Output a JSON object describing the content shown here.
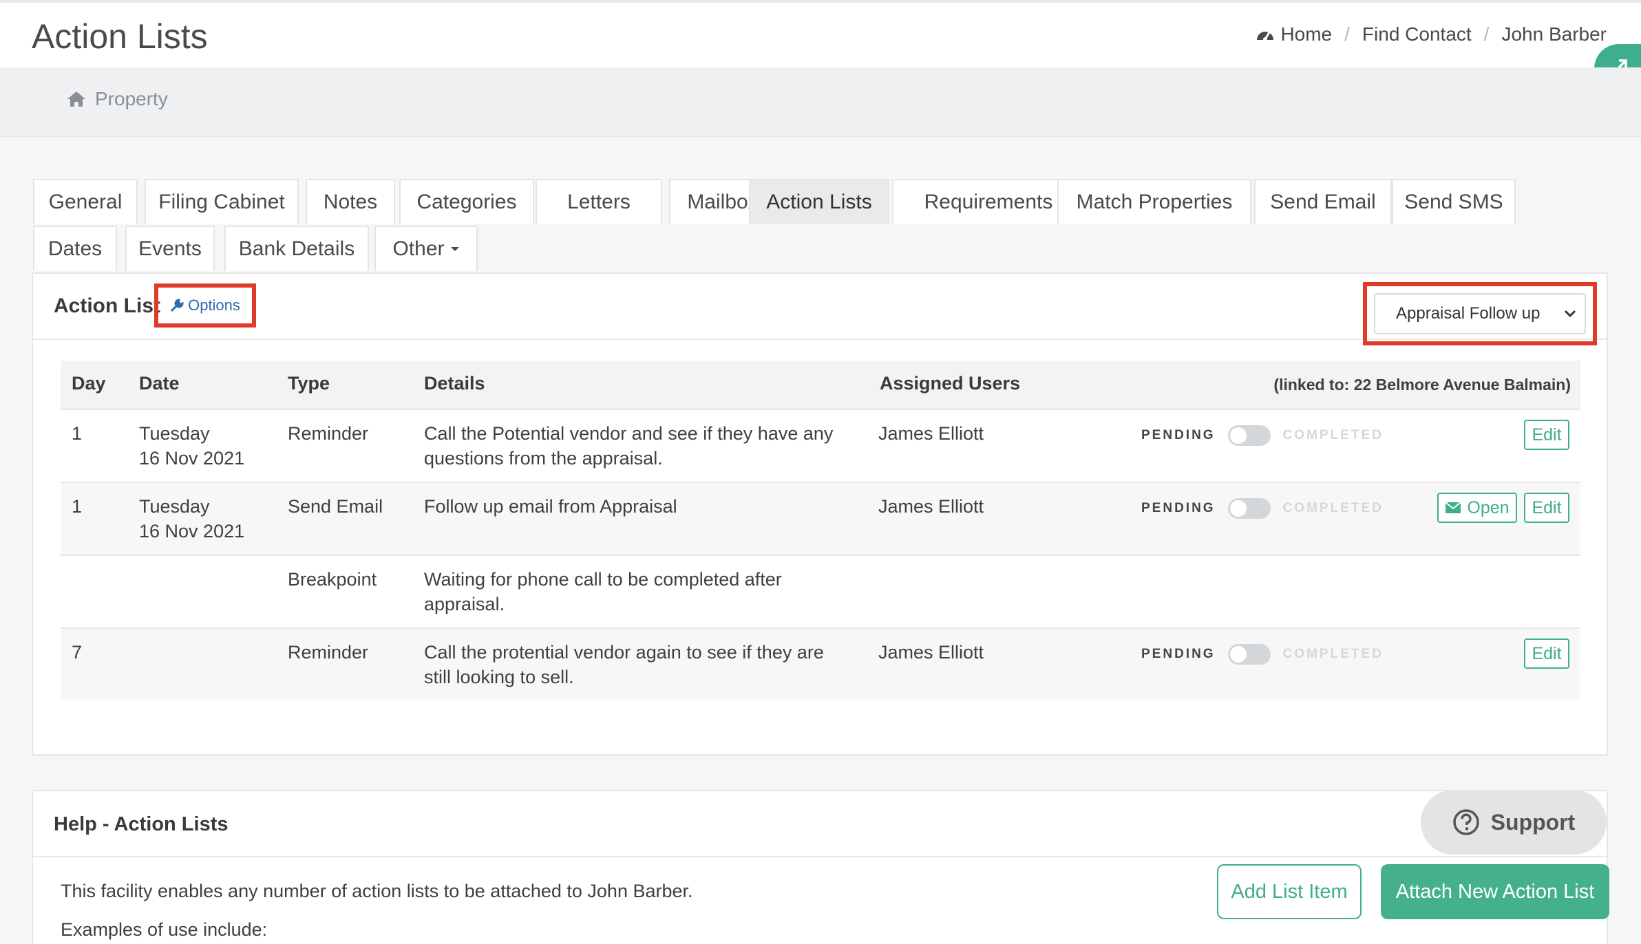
{
  "header": {
    "title": "Action Lists",
    "breadcrumb": [
      "Home",
      "Find Contact",
      "John Barber"
    ]
  },
  "subnav": {
    "property_label": "Property"
  },
  "tabs": [
    {
      "label": "General"
    },
    {
      "label": "Filing Cabinet"
    },
    {
      "label": "Notes"
    },
    {
      "label": "Categories"
    },
    {
      "label": "Letters"
    },
    {
      "label": "Mailbox"
    },
    {
      "label": "Action Lists",
      "active": true
    },
    {
      "label": "Requirements"
    },
    {
      "label": "Match Properties"
    },
    {
      "label": "Send Email"
    },
    {
      "label": "Send SMS"
    },
    {
      "label": "Dates"
    },
    {
      "label": "Events"
    },
    {
      "label": "Bank Details"
    },
    {
      "label": "Other"
    }
  ],
  "action_list": {
    "title": "Action List",
    "options_label": "Options",
    "selected_list": "Appraisal Follow up",
    "columns": [
      "Day",
      "Date",
      "Type",
      "Details",
      "Assigned Users"
    ],
    "linked_to": "(linked to: 22 Belmore Avenue Balmain)",
    "status_pending": "PENDING",
    "status_completed": "COMPLETED",
    "edit_label": "Edit",
    "open_label": "Open",
    "rows": [
      {
        "day": "1",
        "date_day": "Tuesday",
        "date": "16 Nov 2021",
        "type": "Reminder",
        "details_1": "Call the Potential vendor and see if they have any",
        "details_2": "questions from the appraisal.",
        "user": "James Elliott"
      },
      {
        "day": "1",
        "date_day": "Tuesday",
        "date": "16 Nov 2021",
        "type": "Send Email",
        "details_1": "Follow up email from Appraisal",
        "details_2": "",
        "user": "James Elliott"
      },
      {
        "day": "",
        "date_day": "",
        "date": "",
        "type": "Breakpoint",
        "details_1": "Waiting for phone call to be completed after",
        "details_2": "appraisal.",
        "user": ""
      },
      {
        "day": "7",
        "date_day": "",
        "date": "",
        "type": "Reminder",
        "details_1": "Call the protential vendor again to see if they are",
        "details_2": "still looking to sell.",
        "user": "James Elliott"
      }
    ]
  },
  "help": {
    "title": "Help - Action Lists",
    "support_label": "Support",
    "line1": "This facility enables any number of action lists to be attached to John Barber.",
    "line2": "Examples of use include:",
    "add_item_label": "Add List Item",
    "attach_label": "Attach New Action List"
  },
  "colors": {
    "accent": "#3fae8c",
    "highlight": "#e03a2a",
    "link": "#2b6cb0"
  }
}
